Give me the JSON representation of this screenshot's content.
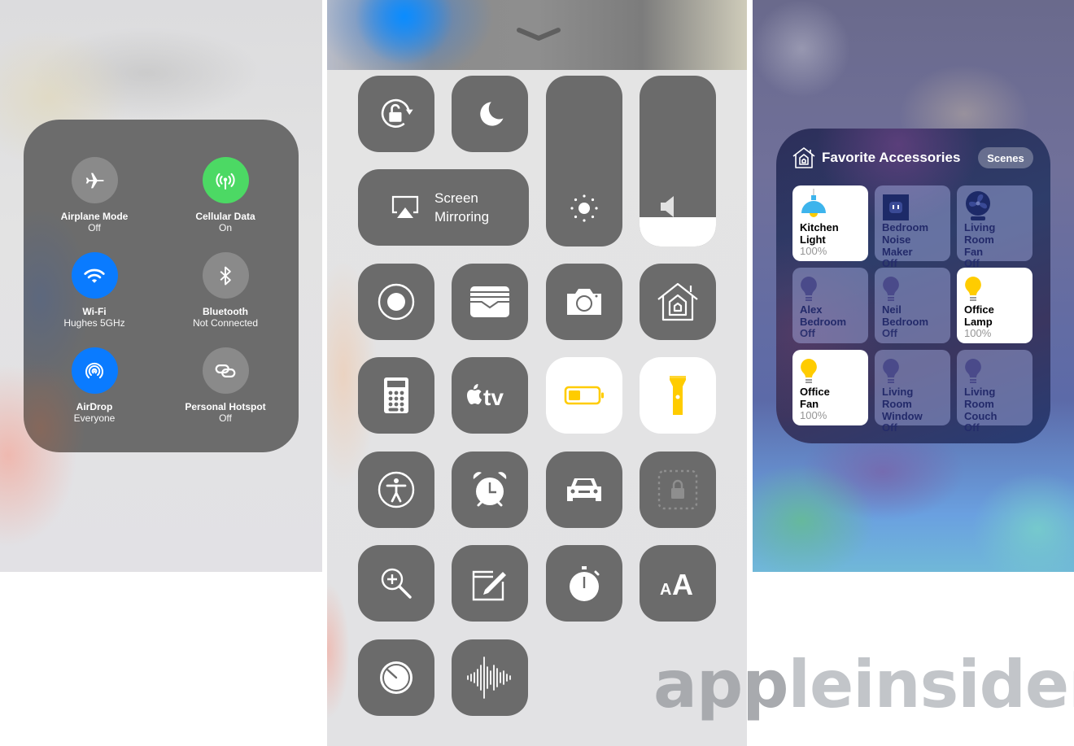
{
  "connectivity": {
    "items": [
      {
        "label": "Airplane Mode",
        "status": "Off",
        "icon": "airplane-icon",
        "state": "off"
      },
      {
        "label": "Cellular Data",
        "status": "On",
        "icon": "cellular-antenna-icon",
        "state": "on",
        "color": "#4cd964"
      },
      {
        "label": "Wi-Fi",
        "status": "Hughes 5GHz",
        "icon": "wifi-icon",
        "state": "on",
        "color": "#0a7bff"
      },
      {
        "label": "Bluetooth",
        "status": "Not Connected",
        "icon": "bluetooth-icon",
        "state": "off"
      },
      {
        "label": "AirDrop",
        "status": "Everyone",
        "icon": "airdrop-icon",
        "state": "on",
        "color": "#0a7bff"
      },
      {
        "label": "Personal Hotspot",
        "status": "Off",
        "icon": "hotspot-link-icon",
        "state": "off"
      }
    ]
  },
  "control_center": {
    "handle_icon": "chevron-down-icon",
    "screen_mirroring": {
      "line1": "Screen",
      "line2": "Mirroring"
    },
    "brightness_level": 0.0,
    "volume_level": 0.17,
    "tiles": [
      {
        "name": "orientation-lock",
        "icon": "rotation-lock-icon",
        "active": false
      },
      {
        "name": "do-not-disturb",
        "icon": "moon-icon",
        "active": false
      },
      {
        "name": "screen-recording",
        "icon": "record-icon",
        "active": false
      },
      {
        "name": "wallet",
        "icon": "wallet-icon",
        "active": false
      },
      {
        "name": "camera",
        "icon": "camera-icon",
        "active": false
      },
      {
        "name": "home",
        "icon": "home-icon",
        "active": false
      },
      {
        "name": "calculator",
        "icon": "calculator-icon",
        "active": false
      },
      {
        "name": "apple-tv-remote",
        "icon": "apple-tv-icon",
        "active": false
      },
      {
        "name": "low-power-mode",
        "icon": "battery-icon",
        "active": true
      },
      {
        "name": "flashlight",
        "icon": "flashlight-icon",
        "active": true
      },
      {
        "name": "accessibility",
        "icon": "accessibility-icon",
        "active": false
      },
      {
        "name": "alarm",
        "icon": "alarm-clock-icon",
        "active": false
      },
      {
        "name": "do-not-disturb-while-driving",
        "icon": "car-icon",
        "active": false
      },
      {
        "name": "guided-access",
        "icon": "guided-access-lock-icon",
        "active": false
      },
      {
        "name": "magnifier",
        "icon": "magnifier-icon",
        "active": false
      },
      {
        "name": "notes",
        "icon": "notes-icon",
        "active": false
      },
      {
        "name": "stopwatch",
        "icon": "stopwatch-icon",
        "active": false
      },
      {
        "name": "text-size",
        "icon": "text-size-icon",
        "active": false
      },
      {
        "name": "timer",
        "icon": "timer-icon",
        "active": false
      },
      {
        "name": "voice-memos",
        "icon": "voice-memo-icon",
        "active": false
      }
    ],
    "accent_yellow": "#ffcc00"
  },
  "home": {
    "title": "Favorite Accessories",
    "scenes_label": "Scenes",
    "accessories": [
      {
        "line1": "Kitchen",
        "line2": "Light",
        "status": "100%",
        "on": true,
        "icon": "pendant-light-icon"
      },
      {
        "line1": "Bedroom",
        "line2": "Noise Maker",
        "status": "Off",
        "on": false,
        "icon": "outlet-icon"
      },
      {
        "line1": "Living Room",
        "line2": "Fan",
        "status": "Off",
        "on": false,
        "icon": "fan-icon"
      },
      {
        "line1": "Alex",
        "line2": "Bedroom",
        "status": "Off",
        "on": false,
        "icon": "bulb-icon"
      },
      {
        "line1": "Neil",
        "line2": "Bedroom",
        "status": "Off",
        "on": false,
        "icon": "bulb-icon"
      },
      {
        "line1": "Office",
        "line2": "Lamp",
        "status": "100%",
        "on": true,
        "icon": "bulb-icon"
      },
      {
        "line1": "Office",
        "line2": "Fan",
        "status": "100%",
        "on": true,
        "icon": "bulb-icon"
      },
      {
        "line1": "Living Room",
        "line2": "Window",
        "status": "Off",
        "on": false,
        "icon": "bulb-icon"
      },
      {
        "line1": "Living Room",
        "line2": "Couch",
        "status": "Off",
        "on": false,
        "icon": "bulb-icon"
      }
    ]
  },
  "watermark": {
    "part1": "app",
    "part2": "leinsider"
  }
}
